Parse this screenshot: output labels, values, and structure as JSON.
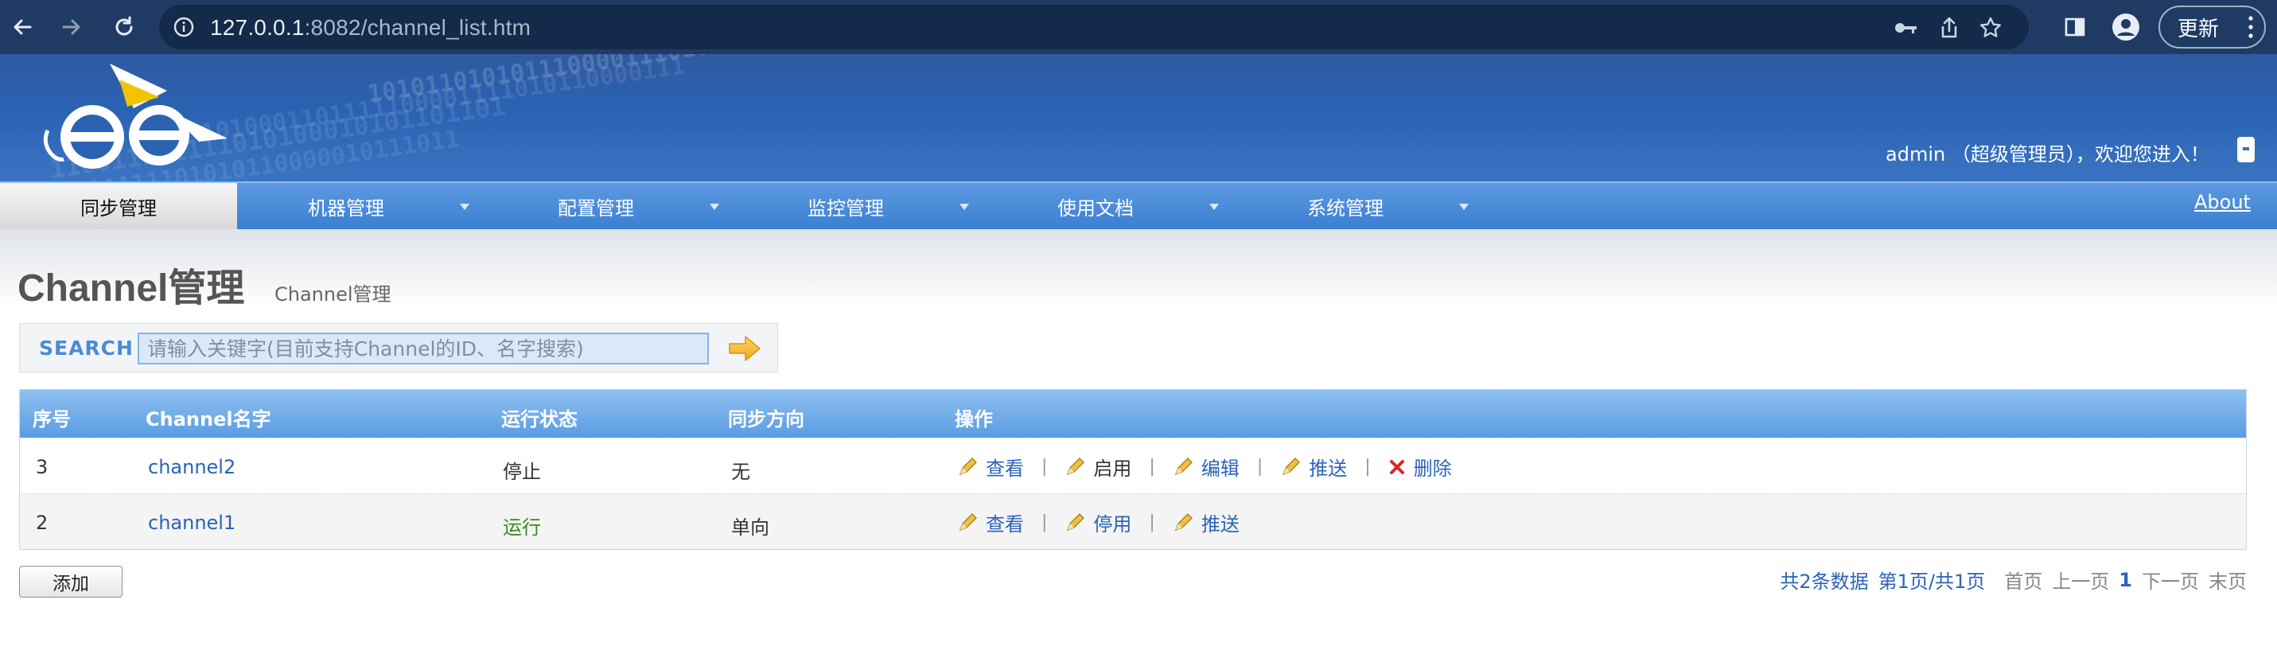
{
  "browser": {
    "url_host": "127.0.0.1",
    "url_rest": ":8082/channel_list.htm",
    "update_label": "更新"
  },
  "header": {
    "user_info": "admin （超级管理员），欢迎您进入！"
  },
  "nav": {
    "items": [
      {
        "label": "同步管理"
      },
      {
        "label": "机器管理"
      },
      {
        "label": "配置管理"
      },
      {
        "label": "监控管理"
      },
      {
        "label": "使用文档"
      },
      {
        "label": "系统管理"
      }
    ],
    "about": "About"
  },
  "page": {
    "title": "Channel管理",
    "subtitle": "Channel管理"
  },
  "search": {
    "label": "SEARCH",
    "placeholder": "请输入关键字(目前支持Channel的ID、名字搜索)"
  },
  "table": {
    "headers": [
      "序号",
      "Channel名字",
      "运行状态",
      "同步方向",
      "操作"
    ],
    "rows": [
      {
        "id": "3",
        "name": "channel2",
        "status": "停止",
        "direction": "无",
        "ops": [
          "查看",
          "启用",
          "编辑",
          "推送",
          "删除"
        ]
      },
      {
        "id": "2",
        "name": "channel1",
        "status": "运行",
        "direction": "单向",
        "ops": [
          "查看",
          "停用",
          "推送"
        ]
      }
    ]
  },
  "footer": {
    "add_label": "添加",
    "total": "共2条数据",
    "page_info": "第1页/共1页",
    "first": "首页",
    "prev": "上一页",
    "current": "1",
    "next": "下一页",
    "last": "末页"
  },
  "colors": {
    "header_blue": "#2a63b3",
    "nav_blue": "#3b7fd2",
    "link_blue": "#2b63b8",
    "running_green": "#3c8b1d",
    "delete_red": "#d9262c"
  }
}
